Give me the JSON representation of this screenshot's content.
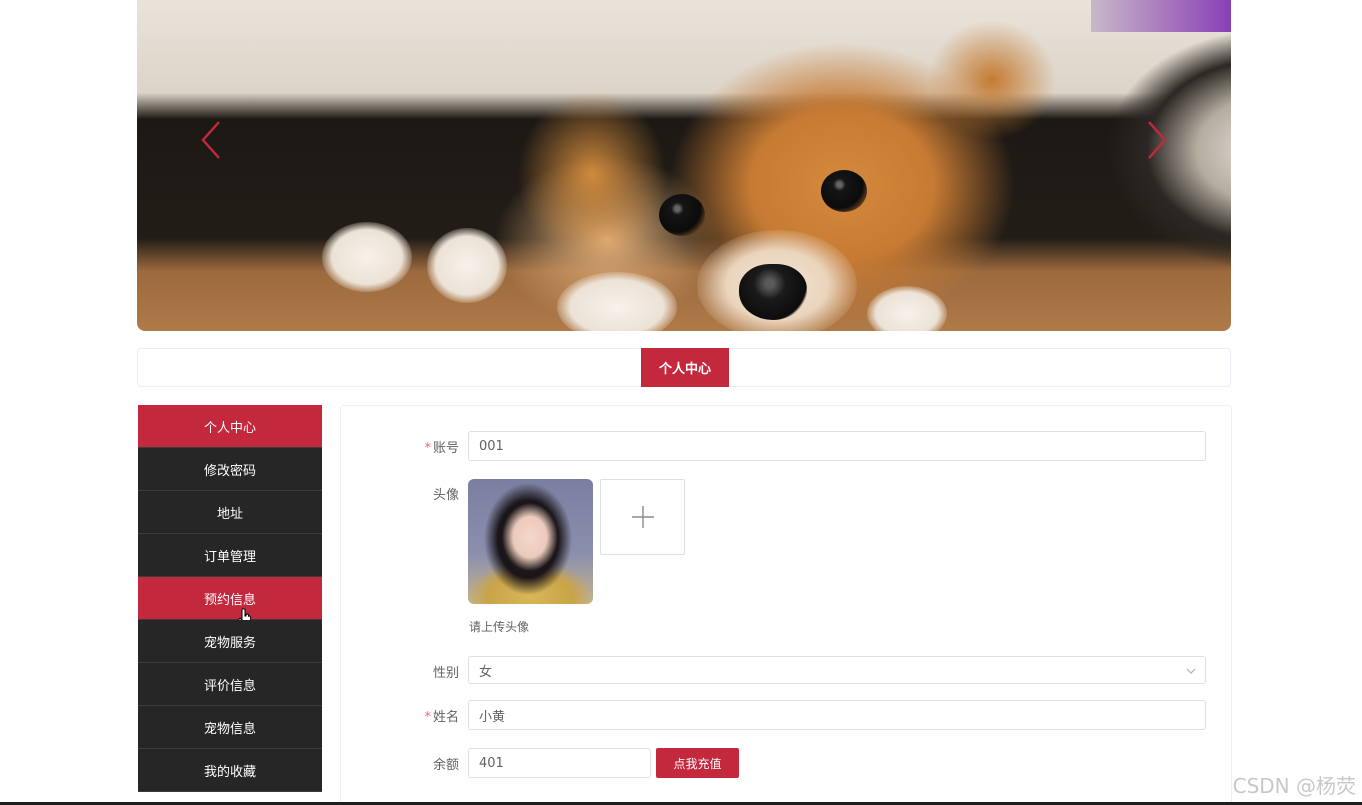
{
  "banner": {
    "prev_icon": "chevron-left-icon",
    "next_icon": "chevron-right-icon",
    "arrow_color": "#c3283c"
  },
  "topnav": {
    "active_tab": "个人中心"
  },
  "sidebar": {
    "items": [
      {
        "label": "个人中心",
        "active": true
      },
      {
        "label": "修改密码"
      },
      {
        "label": "地址"
      },
      {
        "label": "订单管理"
      },
      {
        "label": "预约信息",
        "hover": true
      },
      {
        "label": "宠物服务"
      },
      {
        "label": "评价信息"
      },
      {
        "label": "宠物信息"
      },
      {
        "label": "我的收藏"
      }
    ]
  },
  "form": {
    "account_label": "账号",
    "account_value": "001",
    "avatar_label": "头像",
    "upload_hint": "请上传头像",
    "upload_icon": "plus-icon",
    "gender_label": "性别",
    "gender_value": "女",
    "name_label": "姓名",
    "name_value": "小黄",
    "balance_label": "余额",
    "balance_value": "401",
    "recharge_button": "点我充值",
    "required_mark": "*"
  },
  "watermark": "CSDN @杨荧",
  "colors": {
    "accent": "#c3283c",
    "sidebar_bg": "#262626"
  }
}
